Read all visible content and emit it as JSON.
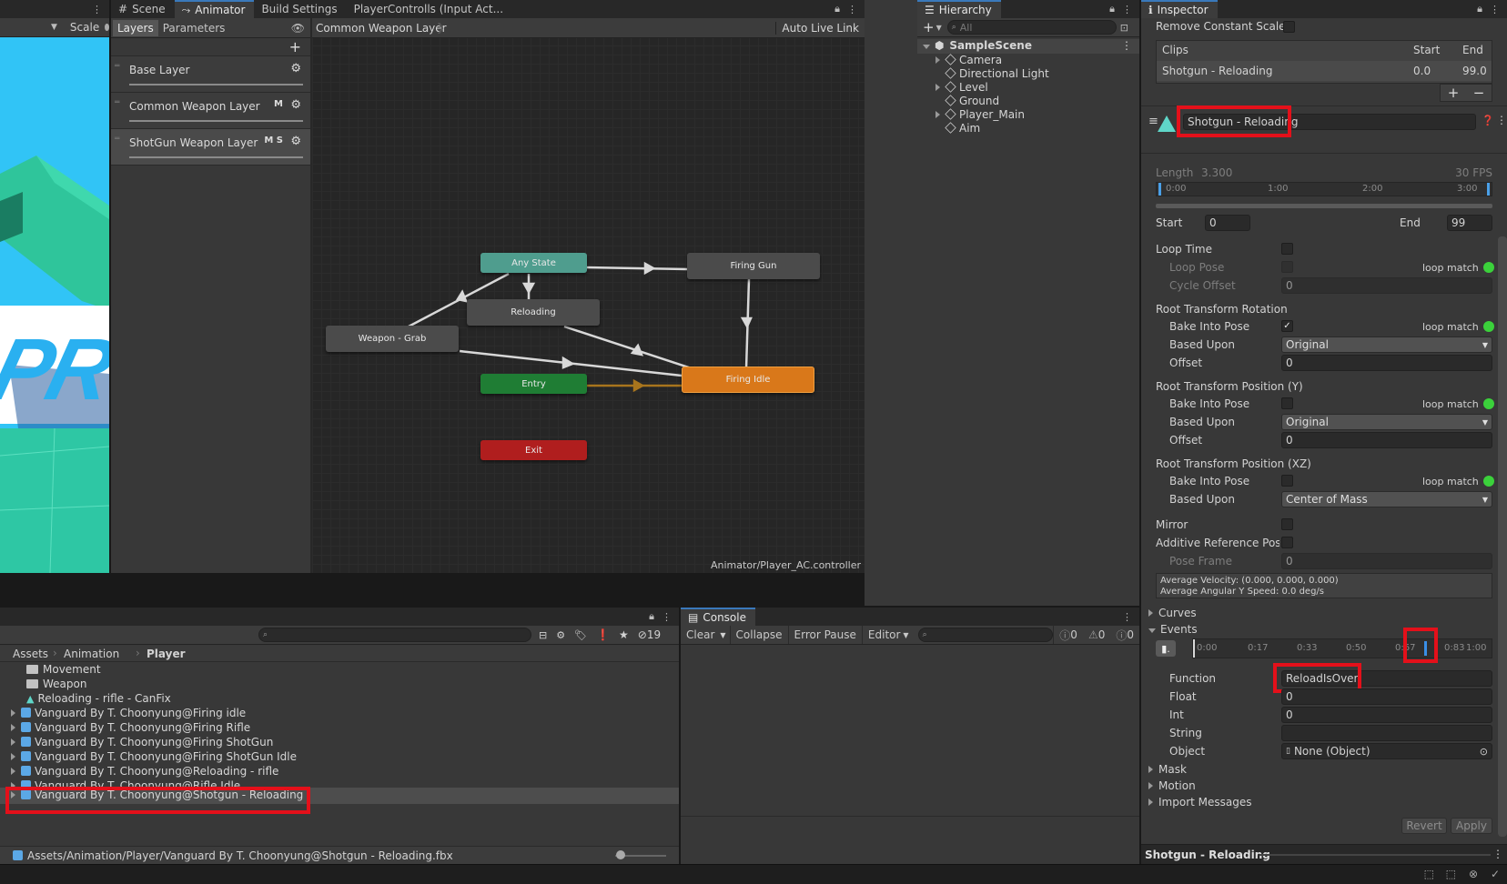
{
  "scene_view": {
    "scale_label": "Scale",
    "watermark_text": "PRO"
  },
  "center_tabs": {
    "scene": "Scene",
    "animator": "Animator",
    "build": "Build Settings",
    "player_controls": "PlayerControlls (Input Act..."
  },
  "animator": {
    "layers_tab": "Layers",
    "parameters_tab": "Parameters",
    "breadcrumb": "Common Weapon Layer",
    "auto_live_link": "Auto Live Link",
    "layers": [
      {
        "name": "Base Layer",
        "badges": ""
      },
      {
        "name": "Common Weapon Layer",
        "badges": "M"
      },
      {
        "name": "ShotGun Weapon Layer",
        "badges": "M S"
      }
    ],
    "nodes": {
      "any_state": "Any State",
      "firing_gun": "Firing Gun",
      "reloading": "Reloading",
      "weapon_grab": "Weapon - Grab",
      "firing_idle": "Firing Idle",
      "entry": "Entry",
      "exit": "Exit"
    },
    "footer_path": "Animator/Player_AC.controller"
  },
  "hierarchy": {
    "tab": "Hierarchy",
    "search_placeholder": "All",
    "scene_name": "SampleScene",
    "items": [
      "Camera",
      "Directional Light",
      "Level",
      "Ground",
      "Player_Main",
      "Aim"
    ]
  },
  "inspector": {
    "tab": "Inspector",
    "remove_constant_scale": "Remove Constant Scale",
    "clips_header": "Clips",
    "start_header": "Start",
    "end_header": "End",
    "clip_name": "Shotgun - Reloading",
    "clip_start": "0.0",
    "clip_end": "99.0",
    "clip_field_name": "Shotgun - Reloading",
    "length_label": "Length",
    "length_value": "3.300",
    "fps": "30 FPS",
    "timeline_ticks": [
      "0:00",
      "1:00",
      "2:00",
      "3:00"
    ],
    "start_label": "Start",
    "start_value": "0",
    "end_label": "End",
    "end_value": "99",
    "loop_time": "Loop Time",
    "loop_pose": "Loop Pose",
    "loop_match": "loop match",
    "cycle_offset": "Cycle Offset",
    "cycle_offset_value": "0",
    "rtr_header": "Root Transform Rotation",
    "bake_into_pose": "Bake Into Pose",
    "based_upon": "Based Upon",
    "offset": "Offset",
    "rtr_based_value": "Original",
    "rtr_offset_value": "0",
    "rtpy_header": "Root Transform Position (Y)",
    "rtpy_based_value": "Original",
    "rtpy_offset_value": "0",
    "rtpxz_header": "Root Transform Position (XZ)",
    "rtpxz_based_value": "Center of Mass",
    "mirror": "Mirror",
    "additive_ref_pose": "Additive Reference Pose",
    "pose_frame": "Pose Frame",
    "pose_frame_value": "0",
    "avg_velocity": "Average Velocity: (0.000, 0.000, 0.000)",
    "avg_angular": "Average Angular Y Speed: 0.0 deg/s",
    "curves": "Curves",
    "events": "Events",
    "event_ticks": [
      "0:00",
      "0:17",
      "0:33",
      "0:50",
      "0:67",
      "0:83",
      "1:00"
    ],
    "function_label": "Function",
    "function_value": "ReloadIsOver",
    "float_label": "Float",
    "float_value": "0",
    "int_label": "Int",
    "int_value": "0",
    "string_label": "String",
    "string_value": "",
    "object_label": "Object",
    "object_value": "None (Object)",
    "mask": "Mask",
    "motion": "Motion",
    "import_messages": "Import Messages",
    "revert": "Revert",
    "apply": "Apply",
    "preview_title": "Shotgun - Reloading"
  },
  "project": {
    "breadcrumb": [
      "Assets",
      "Animation",
      "Player"
    ],
    "hidden_count": "19",
    "items": [
      {
        "type": "folder",
        "name": "Movement"
      },
      {
        "type": "folder",
        "name": "Weapon"
      },
      {
        "type": "anim",
        "name": "Reloading - rifle - CanFix"
      },
      {
        "type": "model",
        "name": "Vanguard By T. Choonyung@Firing idle"
      },
      {
        "type": "model",
        "name": "Vanguard By T. Choonyung@Firing Rifle"
      },
      {
        "type": "model",
        "name": "Vanguard By T. Choonyung@Firing ShotGun"
      },
      {
        "type": "model",
        "name": "Vanguard By T. Choonyung@Firing ShotGun Idle"
      },
      {
        "type": "model",
        "name": "Vanguard By T. Choonyung@Reloading - rifle"
      },
      {
        "type": "model",
        "name": "Vanguard By T. Choonyung@Rifle Idle"
      },
      {
        "type": "model",
        "name": "Vanguard By T. Choonyung@Shotgun - Reloading"
      }
    ],
    "footer_path": "Assets/Animation/Player/Vanguard By T. Choonyung@Shotgun - Reloading.fbx"
  },
  "console": {
    "tab": "Console",
    "clear": "Clear",
    "collapse": "Collapse",
    "error_pause": "Error Pause",
    "editor": "Editor",
    "count_log": "0",
    "count_warn": "0",
    "count_err": "0"
  },
  "colors": {
    "selection_red": "#e4101a",
    "any_state": "#4f9d8e",
    "entry": "#1f7d34",
    "exit": "#b01e1e",
    "firing_idle": "#d9781a",
    "loop_match_green": "#3bd13b"
  }
}
